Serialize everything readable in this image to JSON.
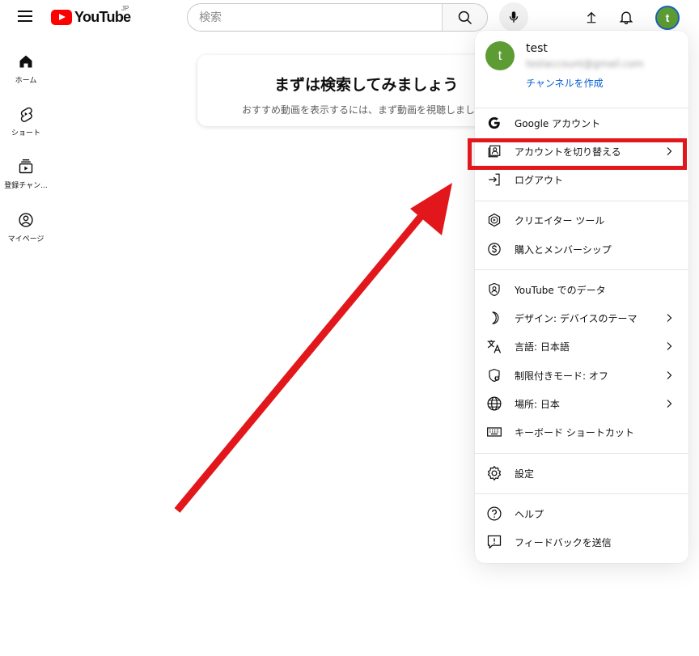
{
  "header": {
    "logo_text": "YouTube",
    "logo_region": "JP",
    "search_placeholder": "検索",
    "avatar_letter": "t"
  },
  "sidebar": {
    "items": [
      {
        "label": "ホーム",
        "icon": "home-icon"
      },
      {
        "label": "ショート",
        "icon": "shorts-icon"
      },
      {
        "label": "登録チャン...",
        "icon": "subscriptions-icon"
      },
      {
        "label": "マイページ",
        "icon": "my-page-icon"
      }
    ]
  },
  "prompt": {
    "title": "まずは検索してみましょう",
    "subtitle": "おすすめ動画を表示するには、まず動画を視聴しましょう"
  },
  "account_menu": {
    "avatar_letter": "t",
    "name": "test",
    "email": "testaccount@gmail.com",
    "create_channel": "チャンネルを作成",
    "items": [
      {
        "label": "Google アカウント",
        "icon": "google-icon",
        "chevron": false
      },
      {
        "label": "アカウントを切り替える",
        "icon": "switch-account-icon",
        "chevron": true
      },
      {
        "label": "ログアウト",
        "icon": "sign-out-icon",
        "chevron": false
      },
      {
        "label": "クリエイター ツール",
        "icon": "creator-tools-icon",
        "chevron": false
      },
      {
        "label": "購入とメンバーシップ",
        "icon": "purchases-icon",
        "chevron": false
      },
      {
        "label": "YouTube でのデータ",
        "icon": "your-data-icon",
        "chevron": false
      },
      {
        "label": "デザイン: デバイスのテーマ",
        "icon": "appearance-icon",
        "chevron": true
      },
      {
        "label": "言語: 日本語",
        "icon": "language-icon",
        "chevron": true
      },
      {
        "label": "制限付きモード: オフ",
        "icon": "restricted-mode-icon",
        "chevron": true
      },
      {
        "label": "場所: 日本",
        "icon": "location-icon",
        "chevron": true
      },
      {
        "label": "キーボード ショートカット",
        "icon": "keyboard-icon",
        "chevron": false
      },
      {
        "label": "設定",
        "icon": "settings-icon",
        "chevron": false
      },
      {
        "label": "ヘルプ",
        "icon": "help-icon",
        "chevron": false
      },
      {
        "label": "フィードバックを送信",
        "icon": "feedback-icon",
        "chevron": false
      }
    ]
  },
  "annotation": {
    "color": "#e2171b"
  }
}
